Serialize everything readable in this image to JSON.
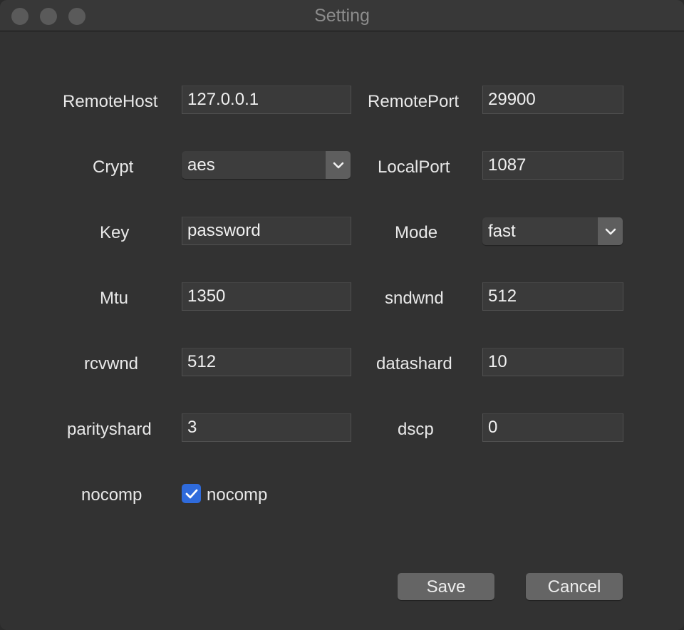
{
  "window": {
    "title": "Setting"
  },
  "form": {
    "remote_host": {
      "label": "RemoteHost",
      "value": "127.0.0.1"
    },
    "remote_port": {
      "label": "RemotePort",
      "value": "29900"
    },
    "crypt": {
      "label": "Crypt",
      "value": "aes"
    },
    "local_port": {
      "label": "LocalPort",
      "value": "1087"
    },
    "key": {
      "label": "Key",
      "value": "password"
    },
    "mode": {
      "label": "Mode",
      "value": "fast"
    },
    "mtu": {
      "label": "Mtu",
      "value": "1350"
    },
    "sndwnd": {
      "label": "sndwnd",
      "value": "512"
    },
    "rcvwnd": {
      "label": "rcvwnd",
      "value": "512"
    },
    "datashard": {
      "label": "datashard",
      "value": "10"
    },
    "parityshard": {
      "label": "parityshard",
      "value": "3"
    },
    "dscp": {
      "label": "dscp",
      "value": "0"
    },
    "nocomp": {
      "label": "nocomp",
      "checkbox_label": "nocomp",
      "checked": true
    }
  },
  "buttons": {
    "save": "Save",
    "cancel": "Cancel"
  },
  "icons": {
    "select_arrow": "chevron-down-icon",
    "checkbox_mark": "checkmark-icon"
  },
  "colors": {
    "background": "#323232",
    "checkbox_accent": "#2f6bdc"
  }
}
